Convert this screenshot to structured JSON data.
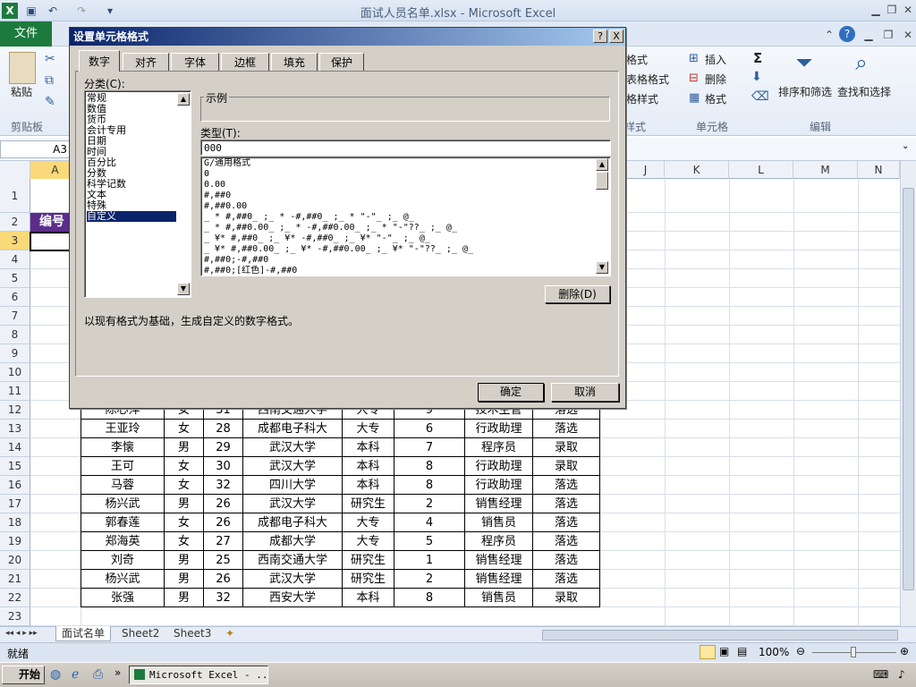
{
  "window": {
    "title": "面试人员名单.xlsx - Microsoft Excel"
  },
  "ribbon": {
    "file_tab": "文件",
    "clipboard": {
      "paste": "粘贴",
      "group": "剪贴板"
    },
    "styles": {
      "conditional": "格式",
      "table": "表格格式",
      "cell": "格样式",
      "group": "样式"
    },
    "cells": {
      "insert": "插入",
      "delete": "删除",
      "format": "格式",
      "group": "单元格"
    },
    "editing": {
      "sort": "排序和筛选",
      "find": "查找和选择",
      "group": "编辑",
      "sigma": "Σ"
    }
  },
  "formula": {
    "name_box": "A3"
  },
  "columns": [
    "A",
    "J",
    "K",
    "L",
    "M",
    "N"
  ],
  "rows": [
    "1",
    "2",
    "3",
    "4",
    "5",
    "6",
    "7",
    "8",
    "9",
    "10",
    "11",
    "12",
    "13",
    "14",
    "15",
    "16",
    "17",
    "18",
    "19",
    "20",
    "21",
    "22",
    "23"
  ],
  "a2_header": "编号",
  "table_rows": [
    [
      "陈心萍",
      "女",
      "31",
      "西南交通大学",
      "大专",
      "9",
      "技术主管",
      "落选"
    ],
    [
      "王亚玲",
      "女",
      "28",
      "成都电子科大",
      "大专",
      "6",
      "行政助理",
      "落选"
    ],
    [
      "李懐",
      "男",
      "29",
      "武汉大学",
      "本科",
      "7",
      "程序员",
      "录取"
    ],
    [
      "王可",
      "女",
      "30",
      "武汉大学",
      "本科",
      "8",
      "行政助理",
      "录取"
    ],
    [
      "马蓉",
      "女",
      "32",
      "四川大学",
      "本科",
      "8",
      "行政助理",
      "落选"
    ],
    [
      "杨兴武",
      "男",
      "26",
      "武汉大学",
      "研究生",
      "2",
      "销售经理",
      "落选"
    ],
    [
      "郭春莲",
      "女",
      "26",
      "成都电子科大",
      "大专",
      "4",
      "销售员",
      "落选"
    ],
    [
      "郑海英",
      "女",
      "27",
      "成都大学",
      "大专",
      "5",
      "程序员",
      "落选"
    ],
    [
      "刘奇",
      "男",
      "25",
      "西南交通大学",
      "研究生",
      "1",
      "销售经理",
      "落选"
    ],
    [
      "杨兴武",
      "男",
      "26",
      "武汉大学",
      "研究生",
      "2",
      "销售经理",
      "落选"
    ],
    [
      "张强",
      "男",
      "32",
      "西安大学",
      "本科",
      "8",
      "销售员",
      "录取"
    ]
  ],
  "sheets": [
    "面试名单",
    "Sheet2",
    "Sheet3"
  ],
  "status": {
    "ready": "就绪",
    "zoom": "100%"
  },
  "taskbar": {
    "start": "开始",
    "excel": "Microsoft Excel - ..."
  },
  "dialog": {
    "title": "设置单元格格式",
    "help": "?",
    "close": "X",
    "tabs": [
      "数字",
      "对齐",
      "字体",
      "边框",
      "填充",
      "保护"
    ],
    "category_label": "分类(C):",
    "categories": [
      "常规",
      "数值",
      "货币",
      "会计专用",
      "日期",
      "时间",
      "百分比",
      "分数",
      "科学记数",
      "文本",
      "特殊",
      "自定义"
    ],
    "selected_category": "自定义",
    "sample_label": "示例",
    "type_label": "类型(T):",
    "type_value": "000",
    "formats": [
      "G/通用格式",
      "0",
      "0.00",
      "#,##0",
      "#,##0.00",
      "_ * #,##0_ ;_ * -#,##0_ ;_ * \"-\"_ ;_ @_",
      "_ * #,##0.00_ ;_ * -#,##0.00_ ;_ * \"-\"??_ ;_ @_",
      "_ ¥* #,##0_ ;_ ¥* -#,##0_ ;_ ¥* \"-\"_ ;_ @_",
      "_ ¥* #,##0.00_ ;_ ¥* -#,##0.00_ ;_ ¥* \"-\"??_ ;_ @_",
      "#,##0;-#,##0",
      "#,##0;[红色]-#,##0"
    ],
    "delete_button": "删除(D)",
    "description": "以现有格式为基础，生成自定义的数字格式。",
    "ok": "确定",
    "cancel": "取消"
  }
}
